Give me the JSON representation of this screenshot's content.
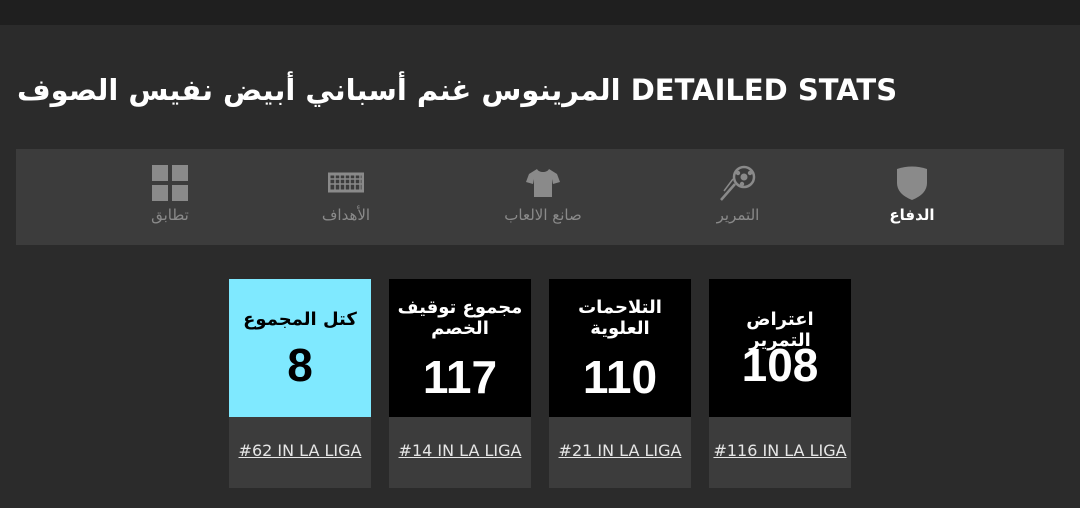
{
  "title": "المرينوس غنم أسباني أبيض نفيس الصوف DETAILED STATS",
  "tabs": [
    {
      "label": "تطابق",
      "icon": "grid-icon",
      "active": false
    },
    {
      "label": "الأهداف",
      "icon": "goal-net-icon",
      "active": false
    },
    {
      "label": "صانع الالعاب",
      "icon": "shirt-icon",
      "active": false
    },
    {
      "label": "التمرير",
      "icon": "ball-pass-icon",
      "active": false
    },
    {
      "label": "الدفاع",
      "icon": "shield-icon",
      "active": true
    }
  ],
  "stats": [
    {
      "label": "كتل المجموع",
      "value": "8",
      "rank": "#62 IN LA LIGA",
      "highlight": true
    },
    {
      "label": "مجموع توقيف الخصم",
      "value": "117",
      "rank": "#14 IN LA LIGA",
      "highlight": false
    },
    {
      "label": "التلاحمات العلوية",
      "value": "110",
      "rank": "#21 IN LA LIGA",
      "highlight": false
    },
    {
      "label": "اعتراض التمرير",
      "value": "108",
      "rank": "#116 IN LA LIGA",
      "highlight": false
    }
  ],
  "colors": {
    "background": "#2b2b2b",
    "panel": "#3c3c3c",
    "card": "#000000",
    "highlight": "#7fe9ff",
    "inactive_text": "#8a8a8a"
  }
}
